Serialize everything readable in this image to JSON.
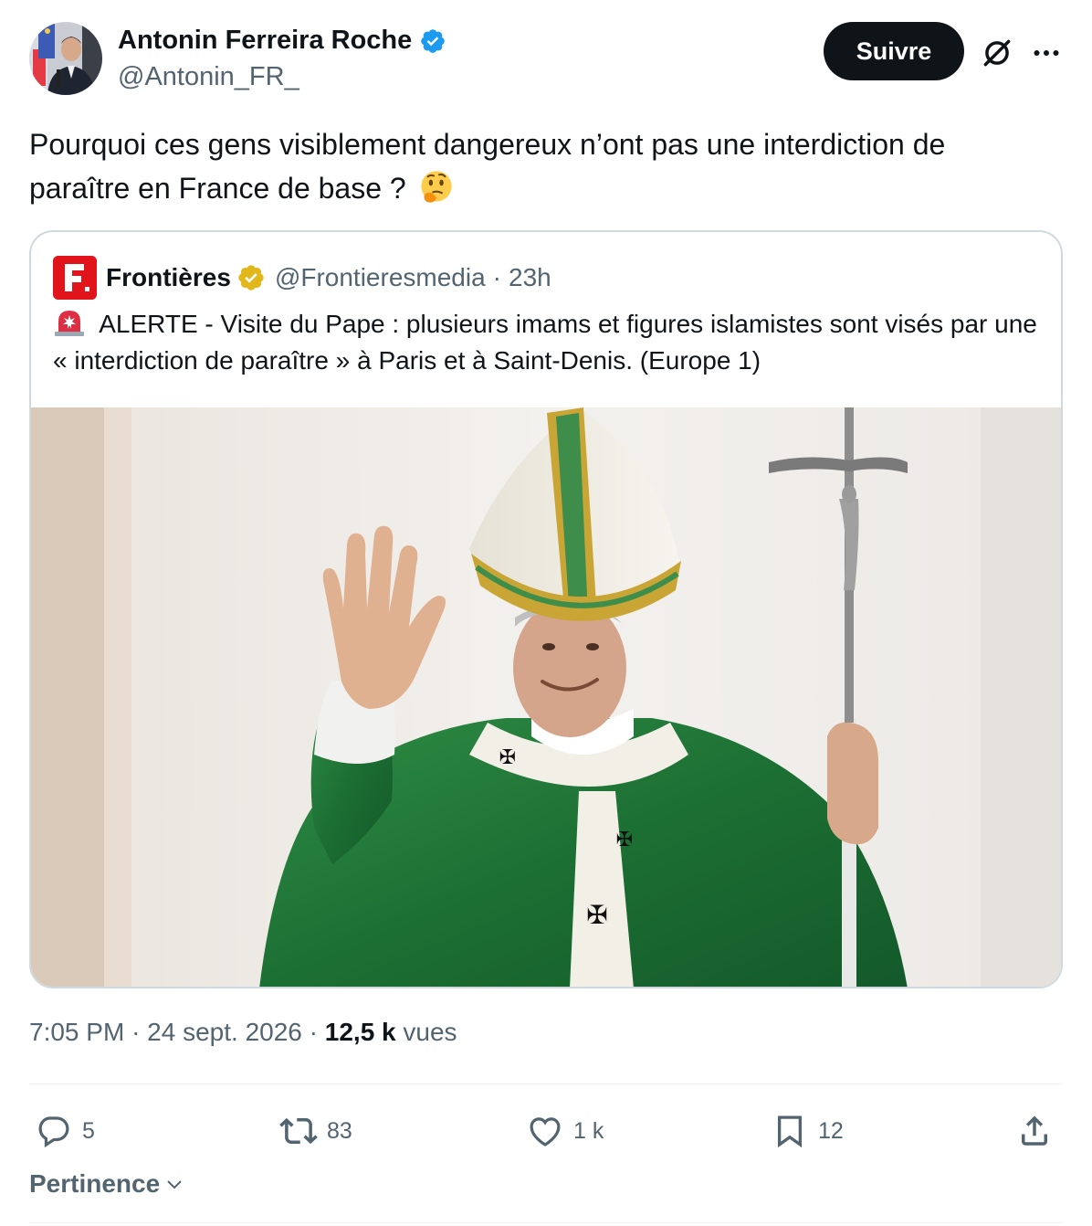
{
  "author": {
    "name": "Antonin Ferreira Roche",
    "handle": "@Antonin_FR_",
    "verified_color": "#1d9bf0"
  },
  "header": {
    "follow_label": "Suivre",
    "grok_icon": "grok-icon",
    "more_icon": "more-icon"
  },
  "tweet": {
    "text": "Pourquoi ces gens visiblement dangereux n’ont pas une interdiction de paraître en France de base ?",
    "emoji": "thinking-face"
  },
  "quote": {
    "name": "Frontières",
    "handle": "@Frontieresmedia",
    "separator": "·",
    "time": "23h",
    "logo_letter": "F",
    "badge_color": "#e2b719",
    "text": "ALERTE - Visite du Pape : plusieurs imams et figures islamistes sont visés par une « interdiction de paraître » à Paris et à Saint-Denis. (Europe 1)",
    "siren_icon": "siren-icon"
  },
  "meta": {
    "time": "7:05 PM",
    "sep1": "·",
    "date": "24 sept. 2026",
    "sep2": "·",
    "views_count": "12,5 k",
    "views_label": "vues"
  },
  "actions": {
    "replies": "5",
    "reposts": "83",
    "likes": "1 k",
    "bookmarks": "12"
  },
  "sort": {
    "label": "Pertinence"
  },
  "colors": {
    "text": "#0f1419",
    "secondary": "#536471",
    "border": "#cfd9de",
    "vestment_green": "#1f7a3a",
    "brand_red": "#e1141c"
  }
}
